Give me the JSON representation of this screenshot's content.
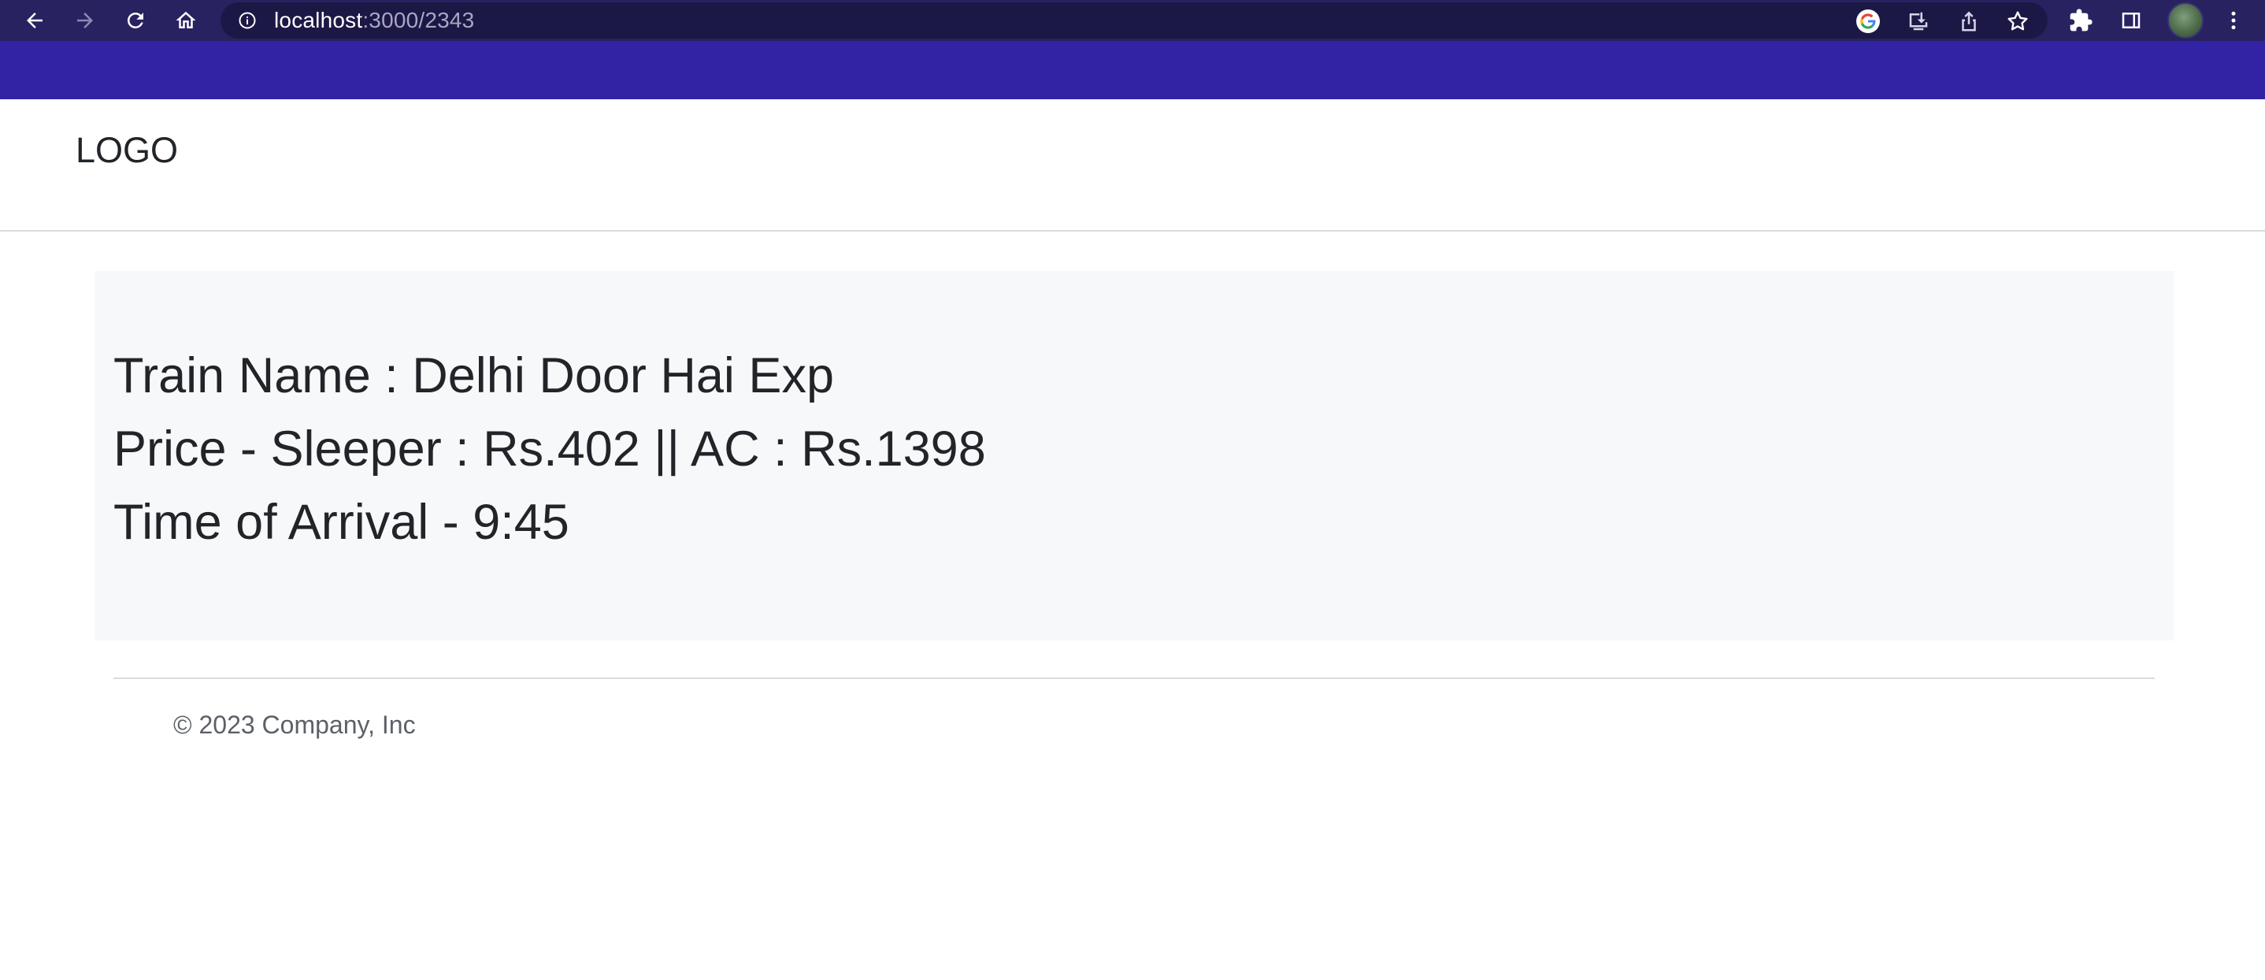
{
  "browser": {
    "url_host": "localhost",
    "url_path": ":3000/2343",
    "icons": [
      "back-icon",
      "forward-icon",
      "reload-icon",
      "home-icon",
      "info-icon",
      "google-icon",
      "install-icon",
      "share-icon",
      "bookmark-star-icon",
      "extensions-icon",
      "side-panel-icon",
      "profile-avatar",
      "menu-icon"
    ]
  },
  "colors": {
    "chrome": "#282261",
    "band": "#3123a3",
    "card": "#f7f8f9",
    "text": "#212529"
  },
  "header": {
    "logo": "LOGO"
  },
  "train": {
    "name_line": "Train Name : Delhi Door Hai Exp",
    "price_line": "Price - Sleeper : Rs.402 || AC : Rs.1398",
    "arrival_line": "Time of Arrival - 9:45"
  },
  "footer": {
    "copyright": "© 2023 Company, Inc"
  }
}
